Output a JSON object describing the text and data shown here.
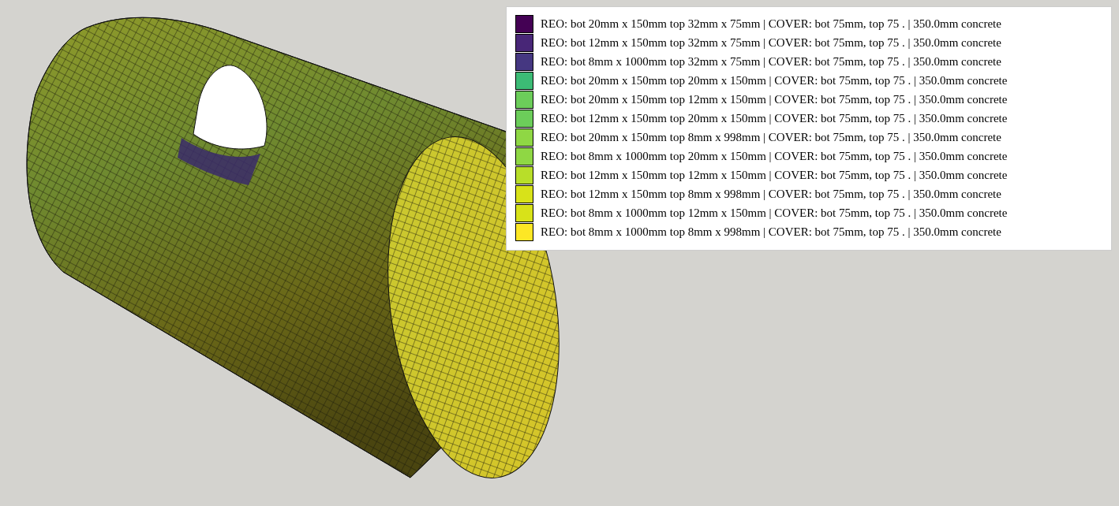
{
  "legend": {
    "items": [
      {
        "label": "REO: bot 20mm x 150mm top 32mm x 75mm | COVER: bot 75mm, top 75 . | 350.0mm concrete",
        "color": "#440154"
      },
      {
        "label": "REO: bot 12mm x 150mm top 32mm x 75mm | COVER: bot 75mm, top 75 . | 350.0mm concrete",
        "color": "#482677"
      },
      {
        "label": "REO: bot 8mm x 1000mm top 32mm x 75mm | COVER: bot 75mm, top 75 . | 350.0mm concrete",
        "color": "#453781"
      },
      {
        "label": "REO: bot 20mm x 150mm top 20mm x 150mm | COVER: bot 75mm, top 75 . | 350.0mm concrete",
        "color": "#3cbb75"
      },
      {
        "label": "REO: bot 20mm x 150mm top 12mm x 150mm | COVER: bot 75mm, top 75 . | 350.0mm concrete",
        "color": "#6ccd5a"
      },
      {
        "label": "REO: bot 12mm x 150mm top 20mm x 150mm | COVER: bot 75mm, top 75 . | 350.0mm concrete",
        "color": "#6ccd5a"
      },
      {
        "label": "REO: bot 20mm x 150mm top 8mm x 998mm | COVER: bot 75mm, top 75 . | 350.0mm concrete",
        "color": "#8fd744"
      },
      {
        "label": "REO: bot 8mm x 1000mm top 20mm x 150mm | COVER: bot 75mm, top 75 . | 350.0mm concrete",
        "color": "#8fd744"
      },
      {
        "label": "REO: bot 12mm x 150mm top 12mm x 150mm | COVER: bot 75mm, top 75 . | 350.0mm concrete",
        "color": "#b8de29"
      },
      {
        "label": "REO: bot 12mm x 150mm top 8mm x 998mm | COVER: bot 75mm, top 75 . | 350.0mm concrete",
        "color": "#d8e219"
      },
      {
        "label": "REO: bot 8mm x 1000mm top 12mm x 150mm | COVER: bot 75mm, top 75 . | 350.0mm concrete",
        "color": "#d8e219"
      },
      {
        "label": "REO: bot 8mm x 1000mm top 8mm x 998mm | COVER: bot 75mm, top 75 . | 350.0mm concrete",
        "color": "#fde725"
      }
    ]
  }
}
